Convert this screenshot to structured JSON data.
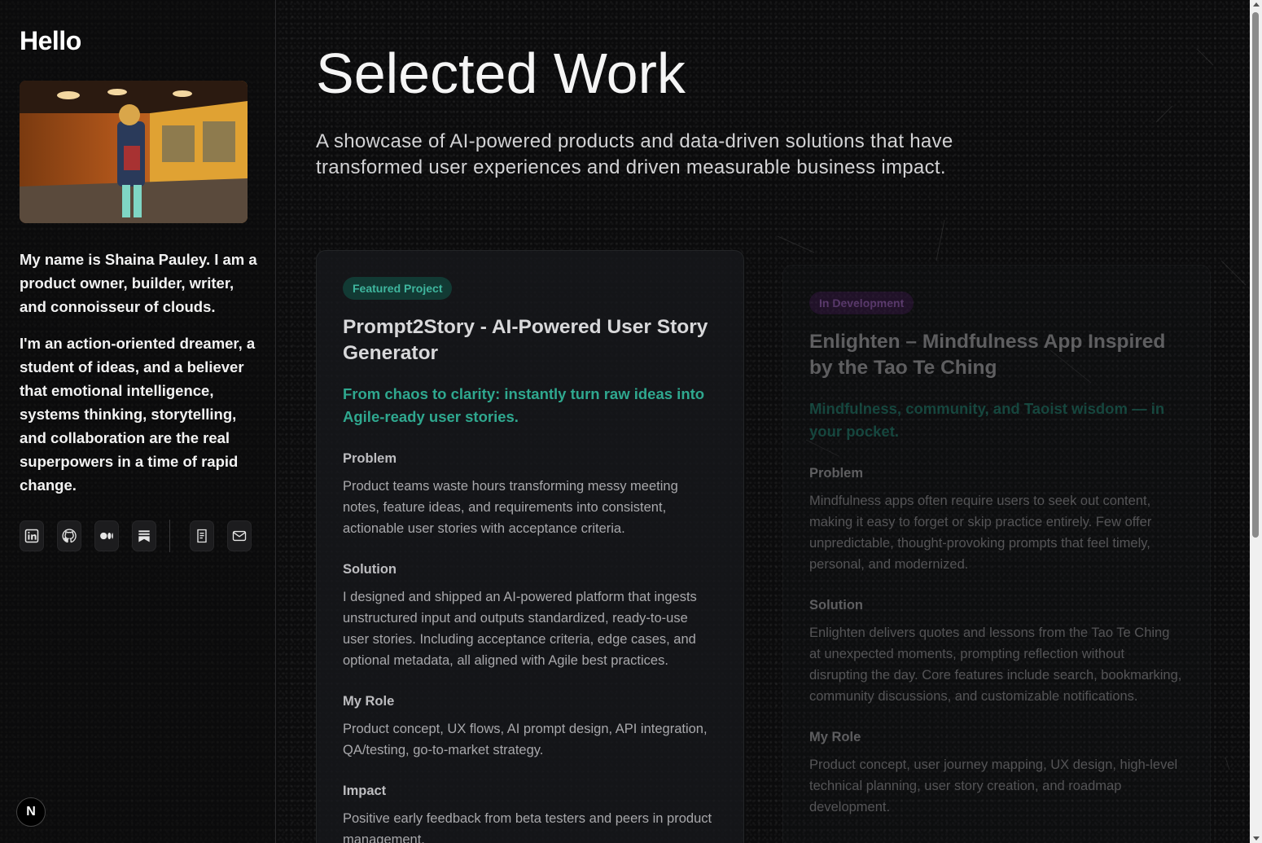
{
  "sidebar": {
    "greeting": "Hello",
    "photo_alt": "Photo of Shaina Pauley in a subway station",
    "bio": [
      "My name is Shaina Pauley. I am a product owner, builder, writer, and connoisseur of clouds.",
      "I'm an action-oriented dreamer, a student of ideas, and a believer that emotional intelligence, systems thinking, storytelling, and collaboration are the real superpowers in a time of rapid change."
    ],
    "socials": [
      {
        "icon": "linkedin-icon"
      },
      {
        "icon": "github-icon"
      },
      {
        "icon": "medium-icon"
      },
      {
        "icon": "substack-icon"
      },
      {
        "icon": "resume-icon"
      },
      {
        "icon": "mail-icon"
      }
    ],
    "next_badge": "N"
  },
  "main": {
    "title": "Selected Work",
    "lead": "A showcase of AI-powered products and data-driven solutions that have transformed user experiences and driven measurable business impact.",
    "cards": [
      {
        "tag": "Featured Project",
        "title": "Prompt2Story - AI-Powered User Story Generator",
        "subtitle": "From chaos to clarity: instantly turn raw ideas into Agile-ready user stories.",
        "sections": [
          {
            "heading": "Problem",
            "text": "Product teams waste hours transforming messy meeting notes, feature ideas, and requirements into consistent, actionable user stories with acceptance criteria."
          },
          {
            "heading": "Solution",
            "text": "I designed and shipped an AI-powered platform that ingests unstructured input and outputs standardized, ready-to-use user stories. Including acceptance criteria, edge cases, and optional metadata, all aligned with Agile best practices."
          },
          {
            "heading": "My Role",
            "text": "Product concept, UX flows, AI prompt design, API integration, QA/testing, go-to-market strategy."
          },
          {
            "heading": "Impact",
            "text": "Positive early feedback from beta testers and peers in product management."
          }
        ]
      },
      {
        "tag": "In Development",
        "title": "Enlighten – Mindfulness App Inspired by the Tao Te Ching",
        "subtitle": "Mindfulness, community, and Taoist wisdom — in your pocket.",
        "sections": [
          {
            "heading": "Problem",
            "text": "Mindfulness apps often require users to seek out content, making it easy to forget or skip practice entirely. Few offer unpredictable, thought-provoking prompts that feel timely, personal, and modernized."
          },
          {
            "heading": "Solution",
            "text": "Enlighten delivers quotes and lessons from the Tao Te Ching at unexpected moments, prompting reflection without disrupting the day. Core features include search, bookmarking, community discussions, and customizable notifications."
          },
          {
            "heading": "My Role",
            "text": "Product concept, user journey mapping, UX design, high-level technical planning, user story creation, and roadmap development."
          }
        ]
      }
    ]
  }
}
